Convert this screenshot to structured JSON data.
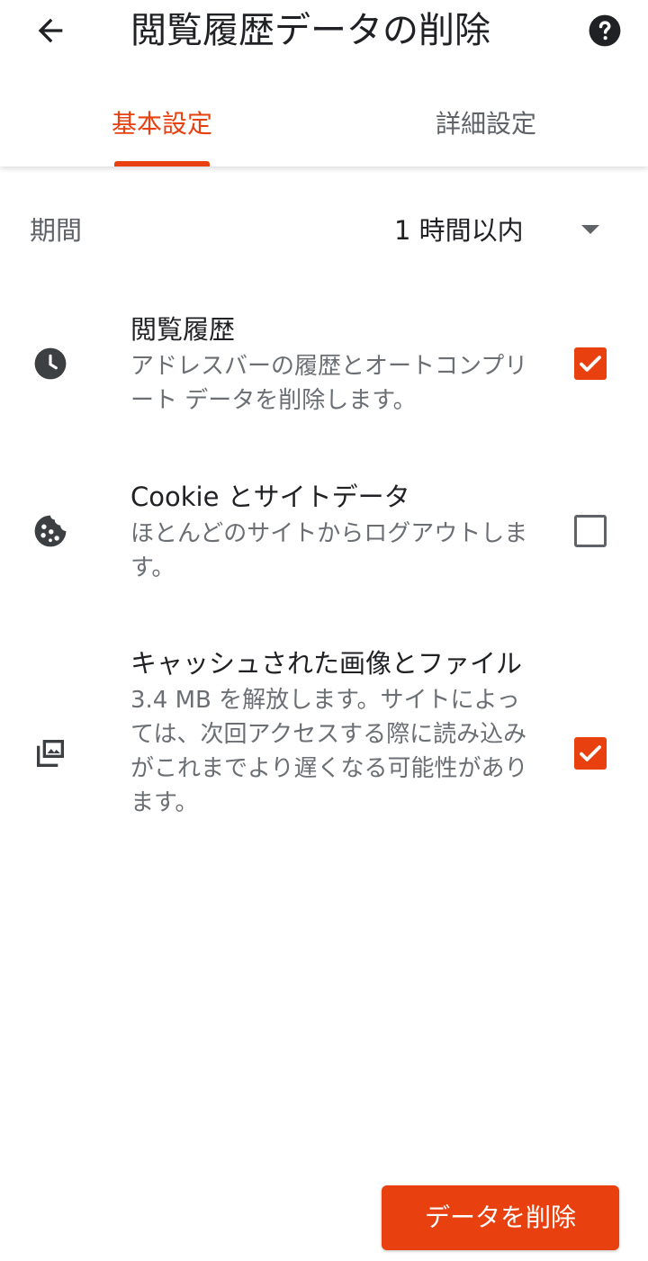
{
  "header": {
    "title": "閲覧履歴データの削除",
    "back_icon": "arrow-back-icon",
    "help_icon": "help-icon"
  },
  "tabs": [
    {
      "label": "基本設定",
      "selected": true
    },
    {
      "label": "詳細設定",
      "selected": false
    }
  ],
  "period": {
    "label": "期間",
    "value": "1 時間以内"
  },
  "options": [
    {
      "icon": "clock-icon",
      "title": "閲覧履歴",
      "description": "アドレスバーの履歴とオートコンプリート データを削除します。",
      "checked": true
    },
    {
      "icon": "cookie-icon",
      "title": "Cookie とサイトデータ",
      "description": "ほとんどのサイトからログアウトします。",
      "checked": false
    },
    {
      "icon": "images-icon",
      "title": "キャッシュされた画像とファイル",
      "description": "3.4 MB を解放します。サイトによっては、次回アクセスする際に読み込みがこれまでより遅くなる可能性があります。",
      "checked": true
    }
  ],
  "actions": {
    "delete_label": "データを削除"
  },
  "colors": {
    "accent": "#e8400f",
    "text_primary": "#202124",
    "text_secondary": "#5f6368"
  }
}
